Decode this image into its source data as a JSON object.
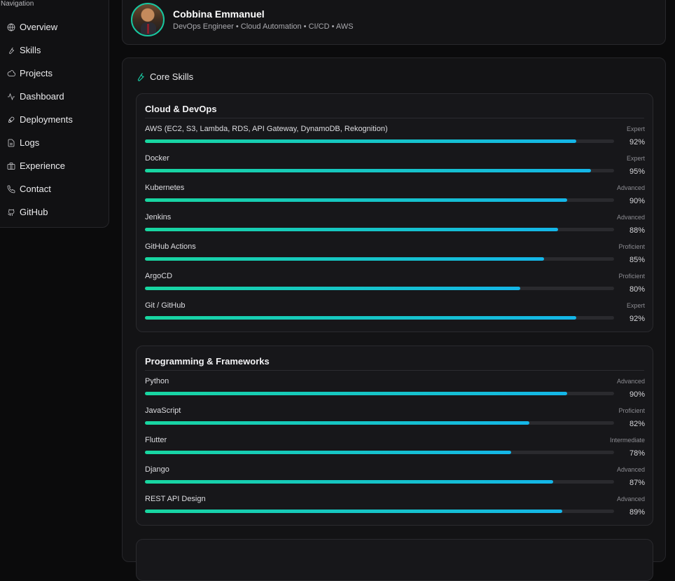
{
  "navigation": {
    "heading": "Navigation",
    "items": [
      {
        "label": "Overview",
        "icon": "globe-icon"
      },
      {
        "label": "Skills",
        "icon": "wrench-icon"
      },
      {
        "label": "Projects",
        "icon": "cloud-icon"
      },
      {
        "label": "Dashboard",
        "icon": "activity-icon"
      },
      {
        "label": "Deployments",
        "icon": "rocket-icon"
      },
      {
        "label": "Logs",
        "icon": "file-icon"
      },
      {
        "label": "Experience",
        "icon": "briefcase-icon"
      },
      {
        "label": "Contact",
        "icon": "phone-icon"
      },
      {
        "label": "GitHub",
        "icon": "github-icon"
      }
    ]
  },
  "profile": {
    "name": "Cobbina Emmanuel",
    "role": "DevOps Engineer • Cloud Automation • CI/CD • AWS"
  },
  "skills": {
    "title": "Core Skills",
    "accent": "#18c7a0",
    "groups": [
      {
        "title": "Cloud & DevOps",
        "items": [
          {
            "name": "AWS (EC2, S3, Lambda, RDS, API Gateway, DynamoDB, Rekognition)",
            "level": "Expert",
            "percent": "92%",
            "value": 92
          },
          {
            "name": "Docker",
            "level": "Expert",
            "percent": "95%",
            "value": 95
          },
          {
            "name": "Kubernetes",
            "level": "Advanced",
            "percent": "90%",
            "value": 90
          },
          {
            "name": "Jenkins",
            "level": "Advanced",
            "percent": "88%",
            "value": 88
          },
          {
            "name": "GitHub Actions",
            "level": "Proficient",
            "percent": "85%",
            "value": 85
          },
          {
            "name": "ArgoCD",
            "level": "Proficient",
            "percent": "80%",
            "value": 80
          },
          {
            "name": "Git / GitHub",
            "level": "Expert",
            "percent": "92%",
            "value": 92
          }
        ]
      },
      {
        "title": "Programming & Frameworks",
        "items": [
          {
            "name": "Python",
            "level": "Advanced",
            "percent": "90%",
            "value": 90
          },
          {
            "name": "JavaScript",
            "level": "Proficient",
            "percent": "82%",
            "value": 82
          },
          {
            "name": "Flutter",
            "level": "Intermediate",
            "percent": "78%",
            "value": 78
          },
          {
            "name": "Django",
            "level": "Advanced",
            "percent": "87%",
            "value": 87
          },
          {
            "name": "REST API Design",
            "level": "Advanced",
            "percent": "89%",
            "value": 89
          }
        ]
      }
    ]
  }
}
